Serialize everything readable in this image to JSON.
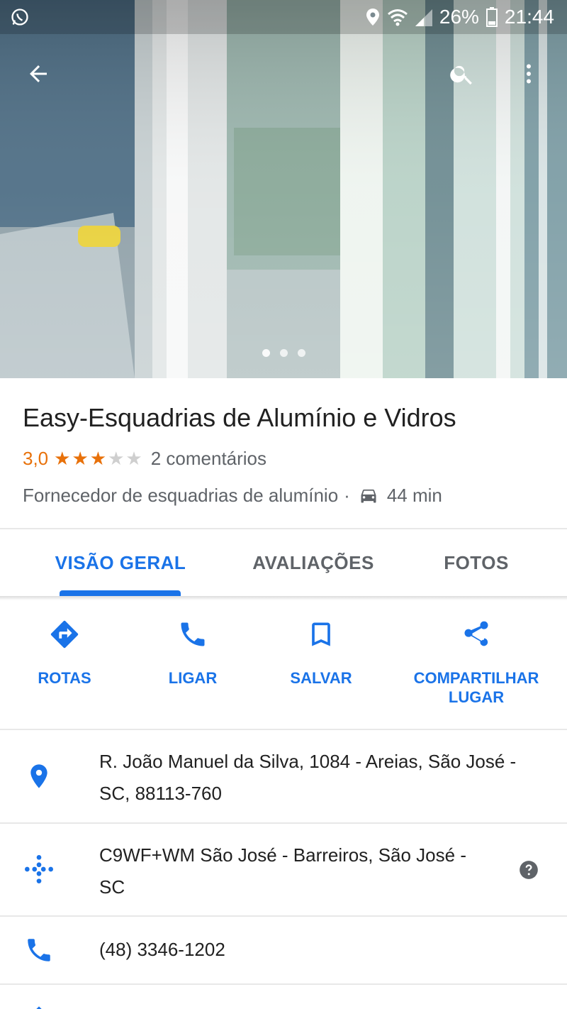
{
  "status_bar": {
    "battery": "26%",
    "time": "21:44"
  },
  "place": {
    "name": "Easy-Esquadrias de Alumínio e Vidros",
    "rating": "3,0",
    "rating_value": 3,
    "rating_max": 5,
    "reviews": "2 comentários",
    "category": "Fornecedor de esquadrias de alumínio",
    "separator": "·",
    "drive_time": "44 min"
  },
  "tabs": [
    {
      "label": "VISÃO GERAL",
      "active": true
    },
    {
      "label": "AVALIAÇÕES",
      "active": false
    },
    {
      "label": "FOTOS",
      "active": false
    }
  ],
  "actions": [
    {
      "label": "ROTAS",
      "icon": "directions-icon"
    },
    {
      "label": "LIGAR",
      "icon": "phone-icon"
    },
    {
      "label": "SALVAR",
      "icon": "bookmark-icon"
    },
    {
      "label": "COMPARTILHAR LUGAR",
      "icon": "share-icon"
    }
  ],
  "info": {
    "address": "R. João Manuel da Silva, 1084 - Areias, São José - SC, 88113-760",
    "plus_code": "C9WF+WM São José - Barreiros, São José - SC",
    "phone": "(48) 3346-1202"
  },
  "photo_pager": {
    "count": 3,
    "current": 1
  },
  "colors": {
    "accent": "#1a73e8",
    "rating": "#e8710a",
    "text_secondary": "#5f6368"
  }
}
